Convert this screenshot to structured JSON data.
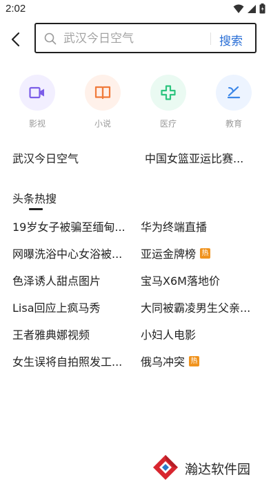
{
  "status_bar": {
    "time": "2:02"
  },
  "search": {
    "placeholder": "武汉今日空气",
    "button_label": "搜索"
  },
  "quick_entries": [
    {
      "label": "影视",
      "icon": "video-camera-icon",
      "color": "#7b5de8",
      "bg": "#f2efff"
    },
    {
      "label": "小说",
      "icon": "open-book-icon",
      "color": "#f07a3a",
      "bg": "#fff1ea"
    },
    {
      "label": "医疗",
      "icon": "medical-cross-icon",
      "color": "#2cc47e",
      "bg": "#eafaf2"
    },
    {
      "label": "教育",
      "icon": "education-icon",
      "color": "#3a86e8",
      "bg": "#edf4ff"
    }
  ],
  "history": [
    "武汉今日空气",
    "中国女篮亚运比赛..."
  ],
  "hot_section": {
    "title": "头条热搜"
  },
  "hot_list": {
    "left": [
      "19岁女子被骗至缅甸...",
      "网曝洗浴中心女浴被...",
      "色泽诱人甜点图片",
      "Lisa回应上疯马秀",
      "王者雅典娜视频",
      "女生误将自拍照发工..."
    ],
    "right": [
      {
        "text": "华为终端直播",
        "badge": ""
      },
      {
        "text": "亚运金牌榜",
        "badge": "热"
      },
      {
        "text": "宝马X6M落地价",
        "badge": ""
      },
      {
        "text": "大同被霸凌男生父亲...",
        "badge": ""
      },
      {
        "text": "小妇人电影",
        "badge": ""
      },
      {
        "text": "俄乌冲突",
        "badge": "热"
      }
    ]
  },
  "watermark": {
    "text": "瀚达软件园"
  },
  "colors": {
    "accent": "#2a6fd6",
    "hot_badge": "#f0931e"
  }
}
